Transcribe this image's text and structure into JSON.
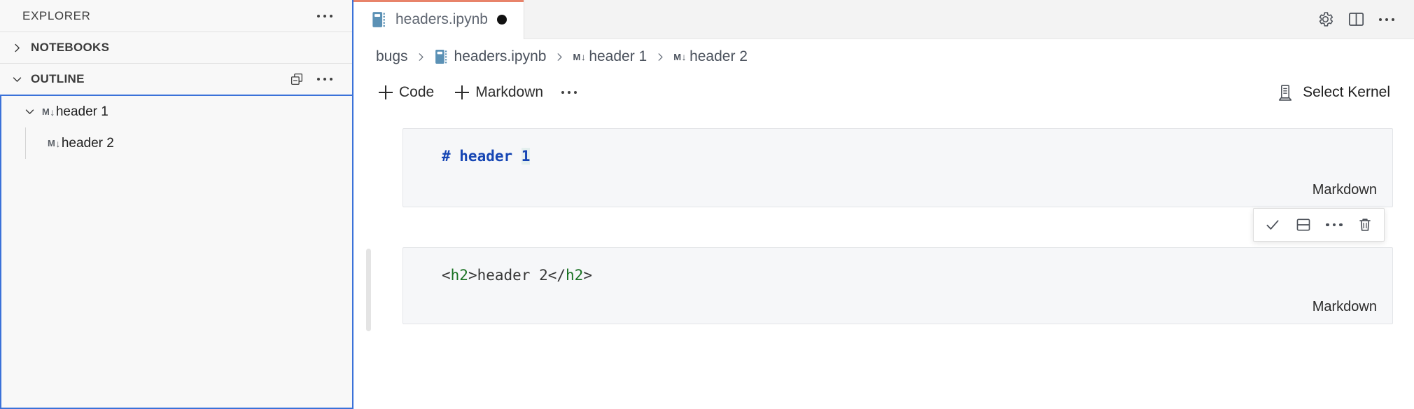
{
  "sidebar": {
    "title": "EXPLORER",
    "more_label": "more-actions",
    "sections": [
      {
        "label": "NOTEBOOKS",
        "expanded": false
      },
      {
        "label": "OUTLINE",
        "expanded": true
      }
    ],
    "outline_items": [
      {
        "label": "header 1",
        "kind_badge": "M",
        "depth": 0,
        "expanded": true
      },
      {
        "label": "header 2",
        "kind_badge": "M",
        "depth": 1,
        "expanded": false
      }
    ]
  },
  "tabs": [
    {
      "label": "headers.ipynb",
      "dirty": true,
      "icon": "notebook-icon",
      "active": true
    }
  ],
  "tabbar_actions": [
    "gear-icon",
    "split-editor-icon",
    "ellipsis-icon"
  ],
  "breadcrumbs": [
    {
      "label": "bugs",
      "icon": null
    },
    {
      "label": "headers.ipynb",
      "icon": "notebook-icon"
    },
    {
      "label": "header 1",
      "icon": "markdown-badge"
    },
    {
      "label": "header 2",
      "icon": "markdown-badge"
    }
  ],
  "breadcrumb_separator": ">",
  "notebook_toolbar": {
    "add_code_label": "Code",
    "add_markdown_label": "Markdown",
    "more_label": "...",
    "kernel_label": "Select Kernel"
  },
  "cells": [
    {
      "kind_label": "Markdown",
      "language": "markdown",
      "source": "# header 1",
      "tokens": [
        {
          "text": "# header ",
          "type": "heading"
        },
        {
          "text": "1",
          "type": "heading-highlight"
        }
      ],
      "focused": false
    },
    {
      "kind_label": "Markdown",
      "language": "html",
      "source": "<h2>header 2</h2>",
      "tokens": [
        {
          "text": "<",
          "type": "bracket"
        },
        {
          "text": "h2",
          "type": "tagname"
        },
        {
          "text": ">header 2</",
          "type": "plain"
        },
        {
          "text": "h2",
          "type": "tagname"
        },
        {
          "text": ">",
          "type": "bracket"
        }
      ],
      "focused": true
    }
  ],
  "cell_actions": [
    "run-check-icon",
    "split-cell-icon",
    "more-icon",
    "delete-icon"
  ],
  "colors": {
    "accent_focus": "#3b72d9",
    "tab_active_top": "#e8836a",
    "sidebar_bg": "#f8f8f8",
    "cell_bg": "#f6f7f9",
    "cell_border": "#e3e5e8",
    "markdown_heading": "#1646b4",
    "html_tagname": "#1a7223"
  }
}
